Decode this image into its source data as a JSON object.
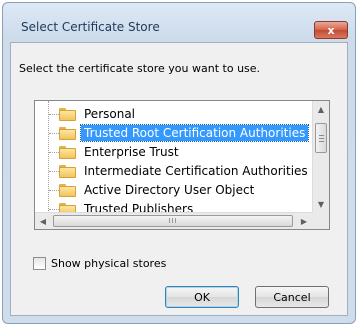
{
  "window": {
    "title": "Select Certificate Store",
    "close_label": "x"
  },
  "prompt": "Select the certificate store you want to use.",
  "tree": {
    "items": [
      {
        "label": "Personal",
        "selected": false
      },
      {
        "label": "Trusted Root Certification Authorities",
        "selected": true
      },
      {
        "label": "Enterprise Trust",
        "selected": false
      },
      {
        "label": "Intermediate Certification Authorities",
        "selected": false
      },
      {
        "label": "Active Directory User Object",
        "selected": false
      },
      {
        "label": "Trusted Publishers",
        "selected": false
      }
    ],
    "hscroll_thumb_grip": "III"
  },
  "checkbox": {
    "label": "Show physical stores",
    "checked": false
  },
  "buttons": {
    "ok": "OK",
    "cancel": "Cancel"
  },
  "colors": {
    "selection": "#3399ff",
    "close_button": "#c44a2e"
  }
}
